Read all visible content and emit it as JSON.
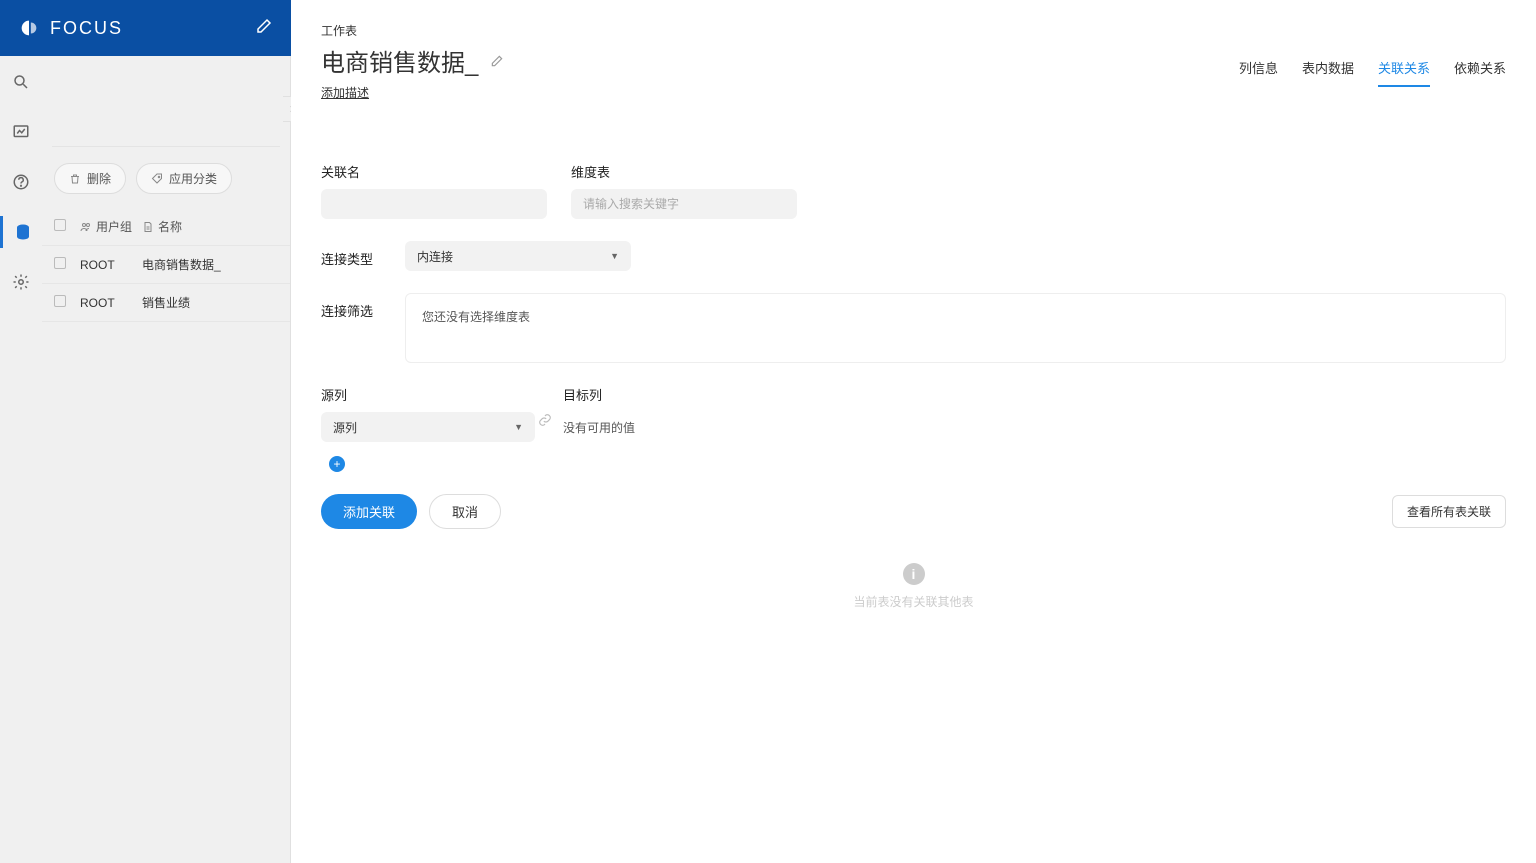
{
  "brand": {
    "name": "FOCUS"
  },
  "sidebar": {
    "delete_label": "删除",
    "category_label": "应用分类",
    "header_group": "用户组",
    "header_name": "名称",
    "rows": [
      {
        "group": "ROOT",
        "name": "电商销售数据_"
      },
      {
        "group": "ROOT",
        "name": "销售业绩"
      }
    ]
  },
  "header": {
    "breadcrumb": "工作表",
    "title": "电商销售数据_",
    "add_desc": "添加描述"
  },
  "tabs": [
    {
      "label": "列信息",
      "active": false
    },
    {
      "label": "表内数据",
      "active": false
    },
    {
      "label": "关联关系",
      "active": true
    },
    {
      "label": "依赖关系",
      "active": false
    }
  ],
  "form": {
    "relation_name_label": "关联名",
    "dim_table_label": "维度表",
    "dim_table_placeholder": "请输入搜索关键字",
    "join_type_label": "连接类型",
    "join_type_value": "内连接",
    "filter_label": "连接筛选",
    "filter_placeholder_text": "您还没有选择维度表",
    "source_col_label": "源列",
    "source_col_value": "源列",
    "target_col_label": "目标列",
    "target_empty": "没有可用的值",
    "add_btn": "添加关联",
    "cancel_btn": "取消",
    "view_all_btn": "查看所有表关联"
  },
  "empty": {
    "text": "当前表没有关联其他表"
  }
}
